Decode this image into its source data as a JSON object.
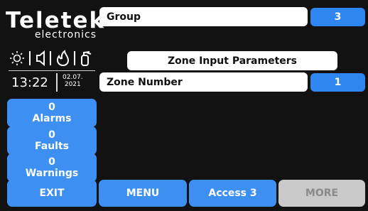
{
  "brand": {
    "name": "Teletek",
    "sub": "electronics"
  },
  "status_icons": [
    "sun-icon",
    "speaker-icon",
    "flame-icon",
    "fire-extinguisher-icon"
  ],
  "clock": {
    "time": "13:22",
    "date_line1": "02.07.",
    "date_line2": "2021"
  },
  "counters": [
    {
      "count": "0",
      "label": "Alarms"
    },
    {
      "count": "0",
      "label": "Faults"
    },
    {
      "count": "0",
      "label": "Warnings"
    }
  ],
  "main": {
    "group_label": "Group",
    "group_value": "3",
    "section_title": "Zone Input Parameters",
    "zone_label": "Zone Number",
    "zone_value": "1"
  },
  "bottom": {
    "exit": "EXIT",
    "menu": "MENU",
    "access": "Access 3",
    "more": "MORE"
  },
  "colors": {
    "background": "#121212",
    "accent_blue": "#3d8ff2",
    "disabled": "#c9c9c9"
  }
}
